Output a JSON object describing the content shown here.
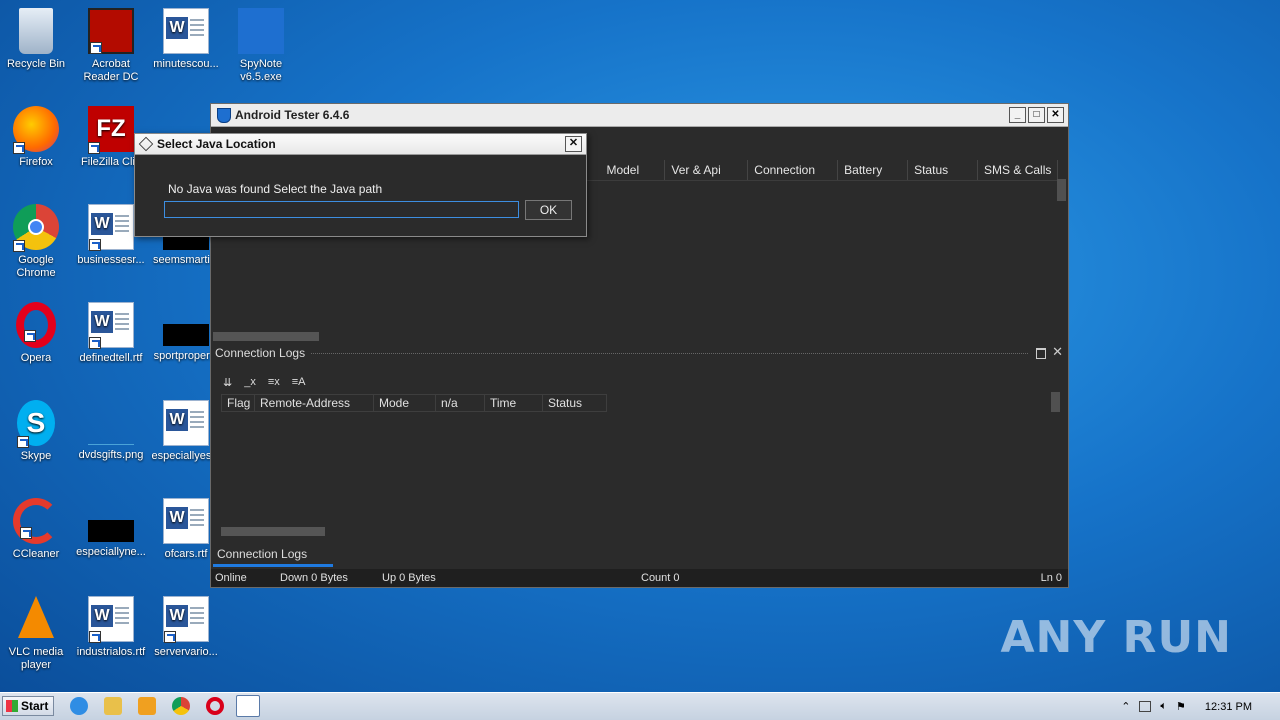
{
  "desktop": {
    "icons": [
      {
        "label": "Recycle Bin"
      },
      {
        "label": "Acrobat Reader DC"
      },
      {
        "label": "minutescou..."
      },
      {
        "label": "SpyNote v6.5.exe"
      },
      {
        "label": "Firefox"
      },
      {
        "label": "FileZilla Clie"
      },
      {
        "label": "Google Chrome"
      },
      {
        "label": "businessesr..."
      },
      {
        "label": "seemsmarti..."
      },
      {
        "label": "Opera"
      },
      {
        "label": "definedtell.rtf"
      },
      {
        "label": "sportproper..."
      },
      {
        "label": "Skype"
      },
      {
        "label": "dvdsgifts.png"
      },
      {
        "label": "especiallyes..."
      },
      {
        "label": "CCleaner"
      },
      {
        "label": "especiallyne..."
      },
      {
        "label": "ofcars.rtf"
      },
      {
        "label": "VLC media player"
      },
      {
        "label": "industrialos.rtf"
      },
      {
        "label": "servervario..."
      }
    ]
  },
  "app": {
    "title": "Android Tester 6.4.6",
    "columns": [
      "Model",
      "Ver & Api",
      "Connection",
      "Battery",
      "Status",
      "SMS & Calls"
    ],
    "logs_pane_title": "Connection Logs",
    "logs_columns": [
      "Flag",
      "Remote-Address",
      "Mode",
      "n/a",
      "Time",
      "Status"
    ],
    "bottom_tab": "Connection Logs",
    "status": {
      "online": "Online",
      "down": "Down 0 Bytes",
      "up": "Up 0 Bytes",
      "count": "Count 0",
      "line": "Ln 0"
    }
  },
  "dialog": {
    "title": "Select Java Location",
    "message": "No Java was found Select the Java path",
    "input_value": "",
    "ok_label": "OK"
  },
  "taskbar": {
    "start_label": "Start",
    "clock": "12:31 PM"
  },
  "watermark": "ANY RUN"
}
